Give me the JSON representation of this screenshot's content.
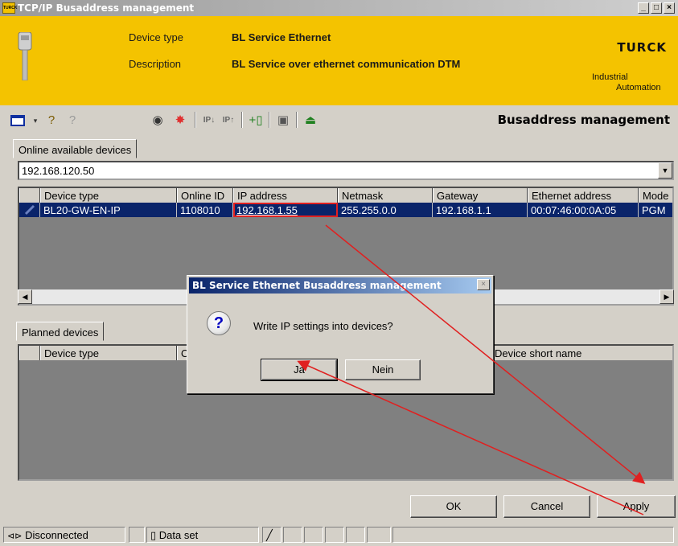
{
  "window": {
    "app_icon": "TURCK",
    "title": "TCP/IP Busaddress management",
    "controls": [
      "_",
      "□",
      "×"
    ]
  },
  "header": {
    "device_type_label": "Device type",
    "device_type_value": "BL Service Ethernet",
    "description_label": "Description",
    "description_value": "BL Service over ethernet communication DTM",
    "brand": "TURCK",
    "tagline_1": "Industrial",
    "tagline_2": "Automation"
  },
  "toolbar": {
    "heading": "Busaddress management",
    "icons": [
      "view-icon",
      "dropdown-icon",
      "help-icon",
      "help-disabled-icon",
      "eye-icon",
      "flash-icon",
      "ip-down-icon",
      "ip-up-icon",
      "add-device-icon",
      "scan-icon",
      "upload-icon"
    ]
  },
  "online_tab": {
    "label": "Online available devices",
    "address_value": "192.168.120.50",
    "columns": [
      "",
      "Device type",
      "Online ID",
      "IP address",
      "Netmask",
      "Gateway",
      "Ethernet address",
      "Mode"
    ],
    "rows": [
      [
        "",
        "BL20-GW-EN-IP",
        "1108010",
        "192.168.1.55",
        "255.255.0.0",
        "192.168.1.1",
        "00:07:46:00:0A:05",
        "PGM"
      ]
    ]
  },
  "planned_tab": {
    "label": "Planned devices",
    "columns": [
      "",
      "Device type",
      "O",
      "Device short name"
    ]
  },
  "dialog": {
    "title": "BL Service Ethernet Busaddress management",
    "message": "Write IP settings into devices?",
    "yes_label": "Ja",
    "no_label": "Nein"
  },
  "footer": {
    "ok_label": "OK",
    "cancel_label": "Cancel",
    "apply_label": "Apply"
  },
  "statusbar": {
    "connection": "Disconnected",
    "dataset": "Data set"
  },
  "colors": {
    "header_yellow": "#f4c300",
    "selection_blue": "#0a246a",
    "annotation_red": "#e02020"
  }
}
